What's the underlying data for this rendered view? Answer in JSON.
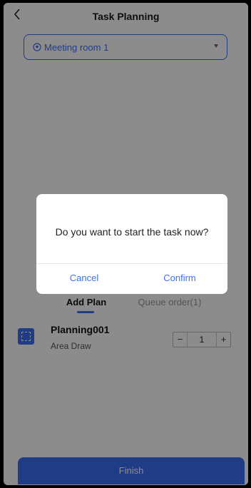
{
  "header": {
    "back_icon": "chevron-left-icon",
    "title": "Task Planning"
  },
  "room_select": {
    "icon": "location-pin-icon",
    "value": "Meeting room 1"
  },
  "tabs": [
    {
      "label": "Add Plan",
      "active": true
    },
    {
      "label": "Queue order(1)",
      "active": false
    }
  ],
  "plans": [
    {
      "icon": "area-draw-icon",
      "name": "Planning001",
      "type": "Area Draw",
      "quantity": "1"
    }
  ],
  "stepper": {
    "minus": "−",
    "plus": "+"
  },
  "finish_label": "Finish",
  "dialog": {
    "message": "Do you want to start the task now?",
    "cancel_label": "Cancel",
    "confirm_label": "Confirm"
  },
  "colors": {
    "accent": "#3b6ef5",
    "overlay": "rgba(0,0,0,0.45)"
  }
}
